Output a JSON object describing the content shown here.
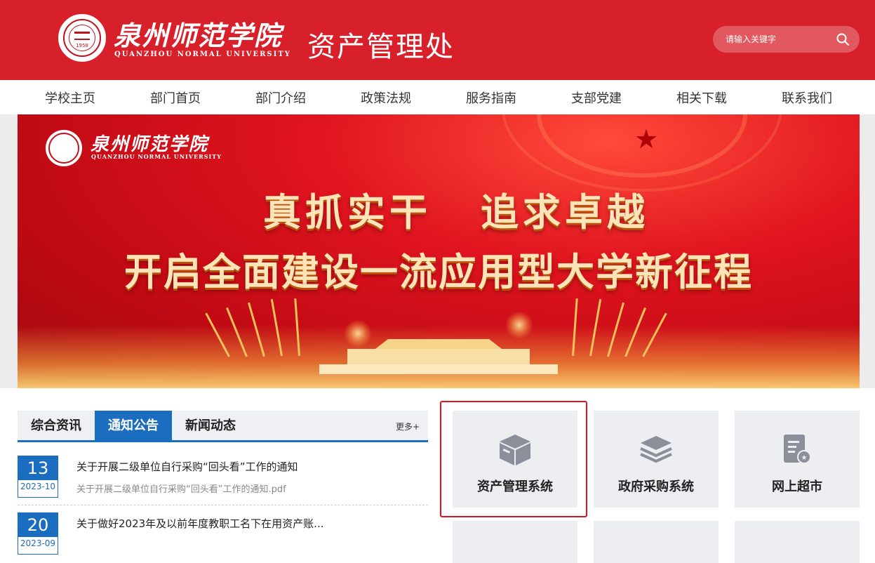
{
  "header": {
    "logo_cn": "泉州师范学院",
    "logo_en": "QUANZHOU NORMAL UNIVERSITY",
    "seal_year": "1958",
    "dept_title": "资产管理处",
    "search_placeholder": "请输入关键字",
    "search_icon": "search-icon"
  },
  "nav": {
    "items": [
      "学校主页",
      "部门首页",
      "部门介绍",
      "政策法规",
      "服务指南",
      "支部党建",
      "相关下载",
      "联系我们"
    ]
  },
  "banner": {
    "logo_cn": "泉州师范学院",
    "logo_en": "QUANZHOU NORMAL UNIVERSITY",
    "slogan1_a": "真抓实干",
    "slogan1_b": "追求卓越",
    "slogan2": "开启全面建设一流应用型大学新征程"
  },
  "news_panel": {
    "tabs": [
      "综合资讯",
      "通知公告",
      "新闻动态"
    ],
    "active_tab": "通知公告",
    "more": "更多+",
    "items": [
      {
        "day": "13",
        "ym": "2023-10",
        "title": "关于开展二级单位自行采购“回头看”工作的通知",
        "sub": "关于开展二级单位自行采购“回头看”工作的通知.pdf"
      },
      {
        "day": "20",
        "ym": "2023-09",
        "title": "关于做好2023年及以前年度教职工名下在用资产账..."
      }
    ]
  },
  "tiles": [
    {
      "label": "资产管理系统",
      "icon": "box-icon"
    },
    {
      "label": "政府采购系统",
      "icon": "layers-icon"
    },
    {
      "label": "网上超市",
      "icon": "document-seal-icon"
    }
  ],
  "colors": {
    "brand_red": "#d7202a",
    "accent_blue": "#1a6dbf",
    "highlight_red": "#e0141f"
  }
}
